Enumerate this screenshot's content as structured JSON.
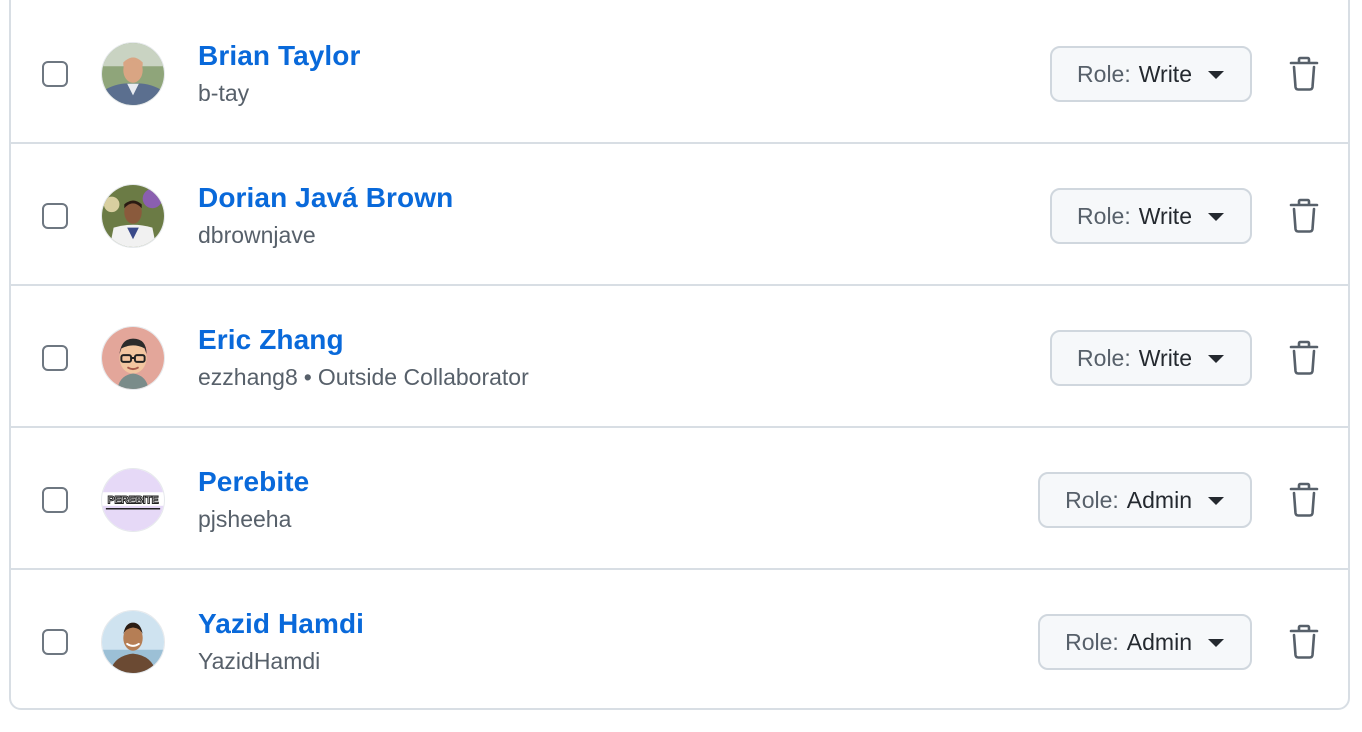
{
  "members": [
    {
      "name": "Brian Taylor",
      "username": "b-tay",
      "extra": "",
      "role_prefix": "Role:",
      "role": "Write",
      "avatar_icon": "avatar-photo-icon"
    },
    {
      "name": "Dorian Javá Brown",
      "username": "dbrownjave",
      "extra": "",
      "role_prefix": "Role:",
      "role": "Write",
      "avatar_icon": "avatar-photo-icon"
    },
    {
      "name": "Eric Zhang",
      "username": "ezzhang8",
      "separator": "•",
      "extra": "Outside Collaborator",
      "role_prefix": "Role:",
      "role": "Write",
      "avatar_icon": "avatar-memoji-icon"
    },
    {
      "name": "Perebite",
      "username": "pjsheeha",
      "extra": "",
      "role_prefix": "Role:",
      "role": "Admin",
      "avatar_text": "PEREBITE",
      "avatar_icon": "avatar-logo-icon"
    },
    {
      "name": "Yazid Hamdi",
      "username": "YazidHamdi",
      "extra": "",
      "role_prefix": "Role:",
      "role": "Admin",
      "avatar_icon": "avatar-photo-icon"
    }
  ],
  "colors": {
    "link": "#0969da",
    "muted": "#57606a",
    "border": "#d8dee4"
  },
  "icons": {
    "delete": "trash-icon",
    "dropdown": "caret-down-icon",
    "select": "checkbox-icon"
  }
}
